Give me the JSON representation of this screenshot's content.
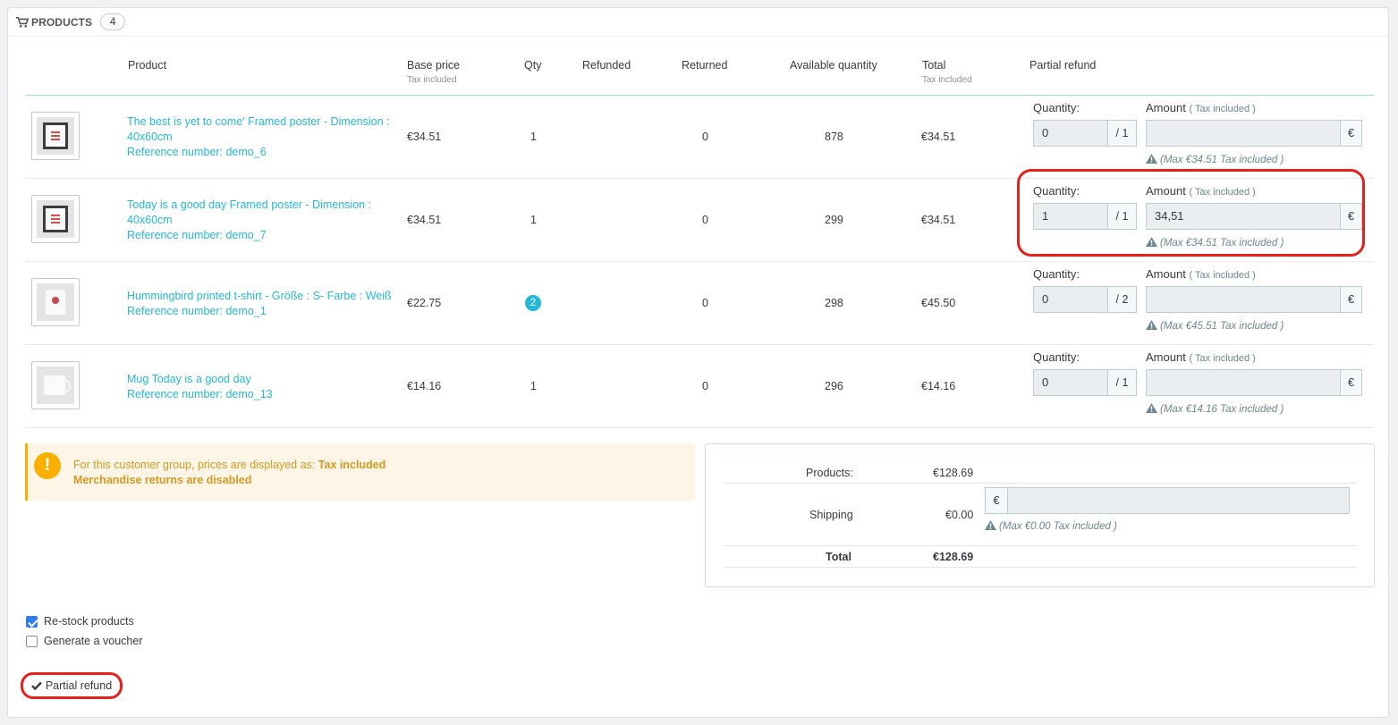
{
  "panel": {
    "title": "PRODUCTS",
    "count": "4"
  },
  "columns": {
    "product": "Product",
    "base_price": "Base price",
    "base_price_sub": "Tax included",
    "qty": "Qty",
    "refunded": "Refunded",
    "returned": "Returned",
    "available": "Available quantity",
    "total": "Total",
    "total_sub": "Tax included",
    "partial_refund": "Partial refund"
  },
  "refund_labels": {
    "quantity": "Quantity:",
    "amount": "Amount",
    "amount_sub": "( Tax included )",
    "currency": "€"
  },
  "products": [
    {
      "name_line1": "The best is yet to come' Framed poster - Dimension :",
      "name_line2": "40x60cm",
      "reference": "Reference number: demo_6",
      "base_price": "€34.51",
      "qty": "1",
      "returned": "0",
      "available": "878",
      "total": "€34.51",
      "refund_qty": "0",
      "refund_max_qty": "/ 1",
      "refund_amount": "",
      "max_hint": "(Max €34.51 Tax included )",
      "icon": "framed-poster-image"
    },
    {
      "name_line1": "Today is a good day Framed poster - Dimension :",
      "name_line2": "40x60cm",
      "reference": "Reference number: demo_7",
      "base_price": "€34.51",
      "qty": "1",
      "returned": "0",
      "available": "299",
      "total": "€34.51",
      "refund_qty": "1",
      "refund_max_qty": "/ 1",
      "refund_amount": "34,51",
      "max_hint": "(Max €34.51 Tax included )",
      "icon": "framed-poster-image"
    },
    {
      "name_line1": "Hummingbird printed t-shirt - Größe : S- Farbe : Weiß",
      "name_line2": "",
      "reference": "Reference number: demo_1",
      "base_price": "€22.75",
      "qty": "2",
      "returned": "0",
      "available": "298",
      "total": "€45.50",
      "refund_qty": "0",
      "refund_max_qty": "/ 2",
      "refund_amount": "",
      "max_hint": "(Max €45.51 Tax included )",
      "icon": "tshirt-image"
    },
    {
      "name_line1": "Mug Today is a good day",
      "name_line2": "",
      "reference": "Reference number: demo_13",
      "base_price": "€14.16",
      "qty": "1",
      "returned": "0",
      "available": "296",
      "total": "€14.16",
      "refund_qty": "0",
      "refund_max_qty": "/ 1",
      "refund_amount": "",
      "max_hint": "(Max €14.16 Tax included )",
      "icon": "mug-image"
    }
  ],
  "alert": {
    "text_prefix": "For this customer group, prices are displayed as: ",
    "text_strong": "Tax included",
    "line2": "Merchandise returns are disabled"
  },
  "totals": {
    "products_label": "Products:",
    "products_value": "€128.69",
    "shipping_label": "Shipping",
    "shipping_value": "€0.00",
    "shipping_currency": "€",
    "shipping_input": "",
    "shipping_hint": "(Max €0.00 Tax included )",
    "total_label": "Total",
    "total_value": "€128.69"
  },
  "options": {
    "restock_label": "Re-stock products",
    "restock_checked": true,
    "voucher_label": "Generate a voucher",
    "voucher_checked": false
  },
  "submit_label": "Partial refund",
  "colors": {
    "link": "#25b9d7",
    "highlight": "#e8201c",
    "warning": "#fab000",
    "checkbox": "#2f7cf6"
  }
}
